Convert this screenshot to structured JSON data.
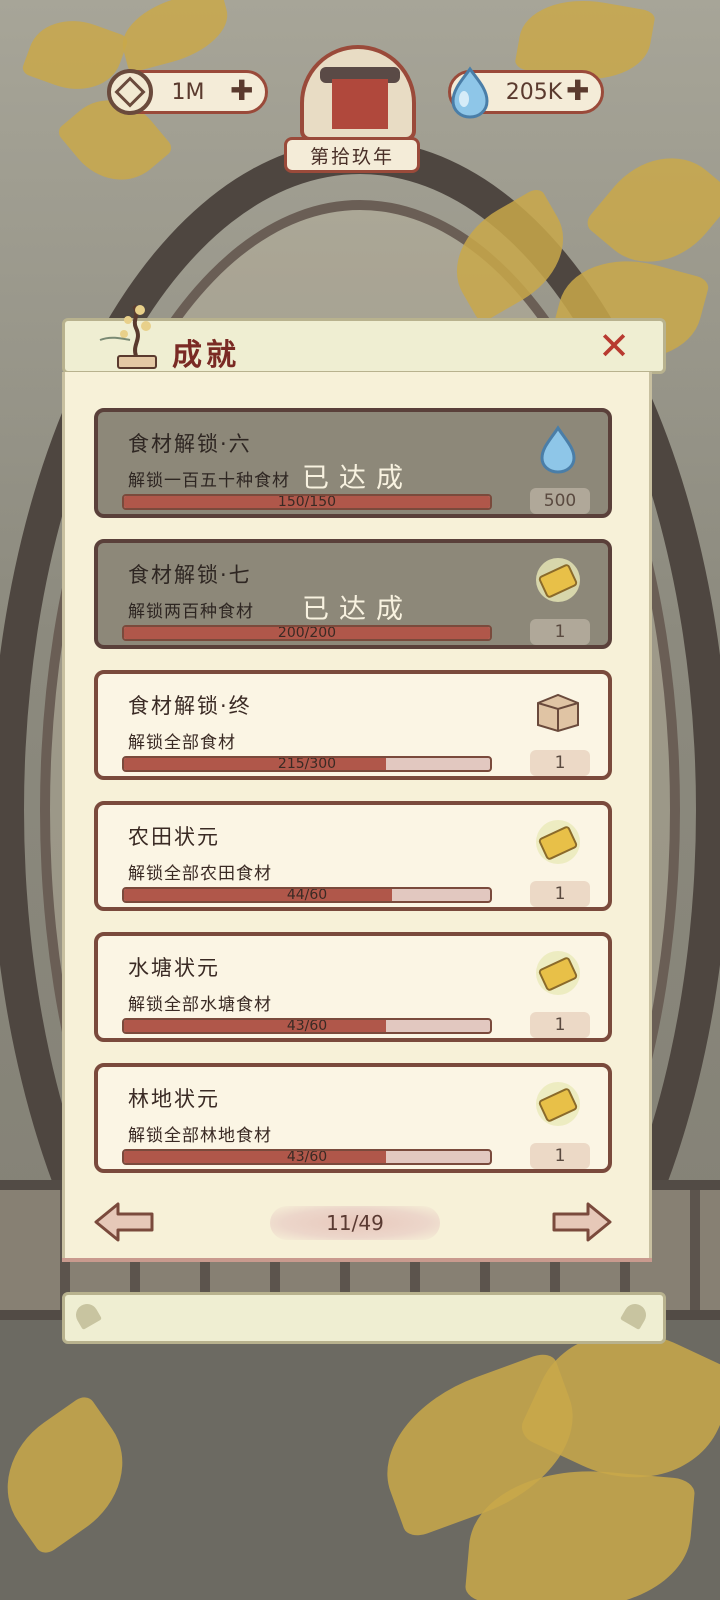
{
  "currency": {
    "coins": "1M",
    "water": "205K"
  },
  "year": "第拾玖年",
  "panel": {
    "title": "成就"
  },
  "achievements": [
    {
      "title": "食材解锁·六",
      "desc": "解锁一百五十种食材",
      "progress": "150/150",
      "fraction": 1.0,
      "reward_icon": "water-drop-icon",
      "reward_count": "500",
      "status": "已达成",
      "done": true
    },
    {
      "title": "食材解锁·七",
      "desc": "解锁两百种食材",
      "progress": "200/200",
      "fraction": 1.0,
      "reward_icon": "ticket-icon",
      "reward_count": "1",
      "status": "已达成",
      "done": true
    },
    {
      "title": "食材解锁·终",
      "desc": "解锁全部食材",
      "progress": "215/300",
      "fraction": 0.717,
      "reward_icon": "wooden-box-icon",
      "reward_count": "1",
      "done": false
    },
    {
      "title": "农田状元",
      "desc": "解锁全部农田食材",
      "progress": "44/60",
      "fraction": 0.733,
      "reward_icon": "ticket-icon",
      "reward_count": "1",
      "done": false
    },
    {
      "title": "水塘状元",
      "desc": "解锁全部水塘食材",
      "progress": "43/60",
      "fraction": 0.717,
      "reward_icon": "ticket-icon",
      "reward_count": "1",
      "done": false
    },
    {
      "title": "林地状元",
      "desc": "解锁全部林地食材",
      "progress": "43/60",
      "fraction": 0.717,
      "reward_icon": "ticket-icon",
      "reward_count": "1",
      "done": false
    }
  ],
  "pager": {
    "page": "11/49"
  },
  "colors": {
    "accent": "#9a4a3a",
    "bar_fill": "#b0574a",
    "close": "#b83a30"
  }
}
